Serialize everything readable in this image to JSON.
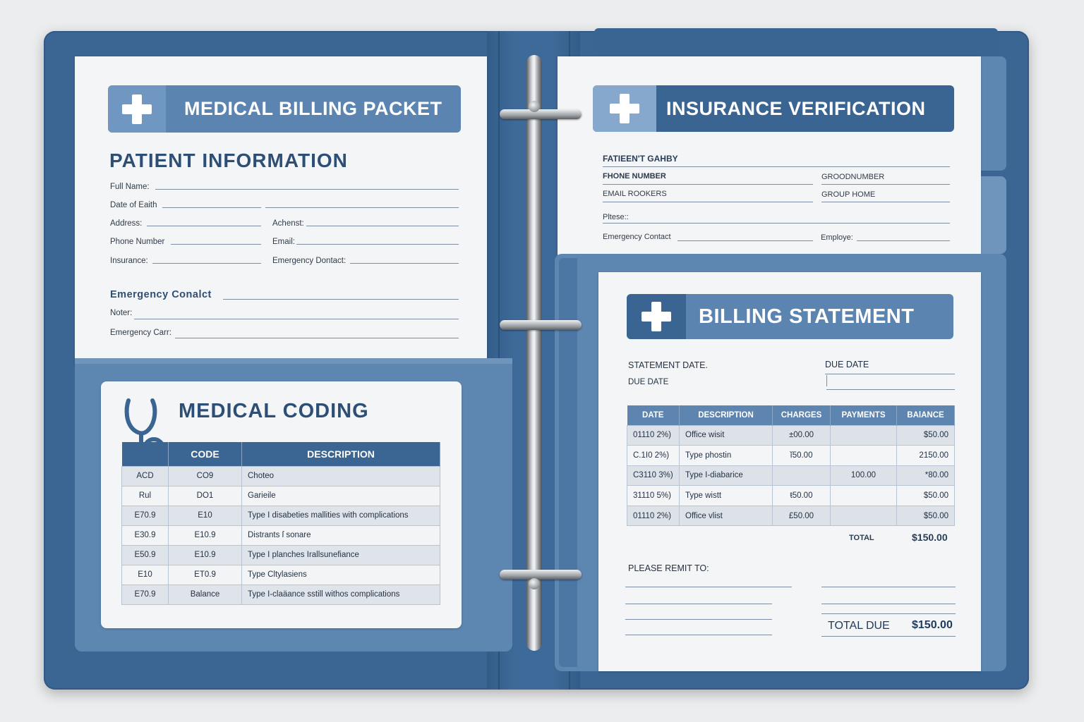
{
  "packet": {
    "title": "MEDICAL BILLING PACKET",
    "patient_info_title": "PATIENT INFORMATION",
    "fields": {
      "full_name": "Full Name:",
      "dob": "Date of Eaith",
      "address": "Address:",
      "achenst": "Achenst:",
      "phone": "Phone Number",
      "email": "Email:",
      "insurance": "Insurance:",
      "emergency_dontact": "Emergency Dontact:"
    },
    "emergency_title": "Emergency Conalct",
    "noter": "Noter:",
    "emergency_carr": "Emergency Carr:"
  },
  "coding": {
    "title": "MEDICAL CODING",
    "headers": [
      "",
      "CODE",
      "DESCRIPTION"
    ],
    "rows": [
      [
        "ACD",
        "CO9",
        "Choteo"
      ],
      [
        "Rul",
        "DO1",
        "Garieile"
      ],
      [
        "E70.9",
        "E10",
        "Type I  disabeties  mallities  with  complications"
      ],
      [
        "E30.9",
        "E10.9",
        "Distrants ſ sonare"
      ],
      [
        "E50.9",
        "E10.9",
        "Type I  planches Irallsunefiance"
      ],
      [
        "E10",
        "ET0.9",
        "Type Cltylasiens"
      ],
      [
        "E70.9",
        "Balance",
        "Type I-claäance sstill withos complications"
      ]
    ]
  },
  "insurance": {
    "title": "INSURANCE VERIFICATION",
    "fields": {
      "patient": "FATIEEN'T GAHBY",
      "phone": "FHONE NUMBER",
      "group_number": "GROODNUMBER",
      "email": "EMAIL ROOKERS",
      "group_home": "GROUP HOME",
      "pltese": "Pltese::",
      "emergency": "Emergency Contact",
      "employe": "Employe:"
    }
  },
  "billing": {
    "title": "BILLING STATEMENT",
    "statement_date": "STATEMENT DATE.",
    "due_date_right": "DUE DATE",
    "due_date_left": "DUE DATE",
    "headers": [
      "DATE",
      "DESCRIPTION",
      "CHARGES",
      "PAYMENTS",
      "BAlANCE"
    ],
    "rows": [
      [
        "01110 2%)",
        "Office wisit",
        "±00.00",
        "",
        "$50.00"
      ],
      [
        "C.1I0 2%)",
        "Type phostin",
        "ĭ50.00",
        "",
        "2150.00"
      ],
      [
        "C3110 3%)",
        "Type I-diabarice",
        "",
        "100.00",
        "*80.00"
      ],
      [
        "31110 5%)",
        "Type wistt",
        "ŧ50.00",
        "",
        "$50.00"
      ],
      [
        "01110 2%)",
        "Office vlist",
        "£50.00",
        "",
        "$50.00"
      ]
    ],
    "total_label": "TOTAL",
    "total_value": "$150.00",
    "remit": "PLEASE REMIT TO:",
    "total_due_label": "TOTAL DUE",
    "total_due_value": "$150.00"
  },
  "colors": {
    "cover": "#3b6593",
    "header": "#5b84b0",
    "header_dark": "#3a6592",
    "paper": "#f4f5f6"
  },
  "icons": [
    "medical-cross-icon",
    "stethoscope-icon"
  ]
}
